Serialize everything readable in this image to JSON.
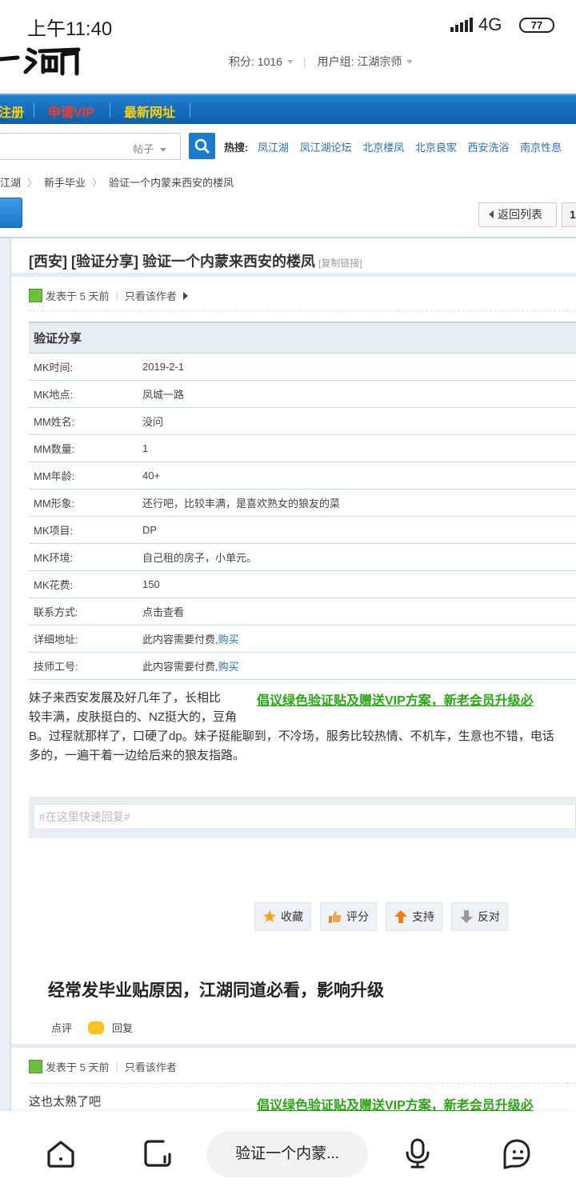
{
  "status_bar": {
    "time": "上午11:40",
    "network": "4G",
    "battery": "77"
  },
  "header": {
    "points_label": "积分: 1016",
    "usergroup_label": "用户组: 江湖宗师"
  },
  "nav": [
    {
      "label": "注册",
      "color": "#ffd200"
    },
    {
      "label": "申请VIP",
      "color": "#ff3b1f"
    },
    {
      "label": "最新网址",
      "color": "#ffd200"
    }
  ],
  "search": {
    "type": "帖子",
    "hot_label": "热搜:",
    "hot_keywords": [
      "凤江湖",
      "凤江湖论坛",
      "北京楼凤",
      "北京良家",
      "西安洗浴",
      "南京性息"
    ]
  },
  "breadcrumb": [
    "江湖",
    "新手毕业",
    "验证一个内蒙来西安的楼凤"
  ],
  "toolbar": {
    "back_label": "返回列表",
    "page": "1"
  },
  "post": {
    "title": "[西安] [验证分享] 验证一个内蒙来西安的楼凤",
    "copy_link": "[复制链接]",
    "posted": "发表于 5 天前",
    "only_author": "只看该作者",
    "table_header": "验证分享",
    "rows": [
      {
        "k": "MK时间:",
        "v": "2019-2-1",
        "link": ""
      },
      {
        "k": "MK地点:",
        "v": "凤城一路",
        "link": ""
      },
      {
        "k": "MM姓名:",
        "v": "没问",
        "link": ""
      },
      {
        "k": "MM数量:",
        "v": "1",
        "link": ""
      },
      {
        "k": "MM年龄:",
        "v": "40+",
        "link": ""
      },
      {
        "k": "MM形象:",
        "v": "还行吧，比较丰满，是喜欢熟女的狼友的菜",
        "link": ""
      },
      {
        "k": "MK项目:",
        "v": "DP",
        "link": ""
      },
      {
        "k": "MK环境:",
        "v": "自己租的房子，小单元。",
        "link": ""
      },
      {
        "k": "MK花费:",
        "v": "150",
        "link": ""
      },
      {
        "k": "联系方式:",
        "v": "点击查看",
        "link": ""
      },
      {
        "k": "详细地址:",
        "v": "此内容需要付费,",
        "link": "购买"
      },
      {
        "k": "技师工号:",
        "v": "此内容需要付费,",
        "link": "购买"
      }
    ],
    "body_line1": "妹子来西安发展及好几年了，长相比",
    "body_line2": "较丰满，皮肤挺白的、NZ挺大的，豆角",
    "body_line3": "B。过程就那样了，口硬了dp。妹子挺能聊到，不冷场，服务比较热情、不机车，生意也不错，电话",
    "body_line4": "多的，一遍干着一边给后来的狼友指路。",
    "promo": "倡议绿色验证贴及赠送VIP方案，新老会员升级必",
    "reply_placeholder": "#在这里快速回复#",
    "actions": [
      "收藏",
      "评分",
      "支持",
      "反对"
    ],
    "tip": "经常发毕业贴原因，江湖同道必看，影响升级",
    "comment_label": "点评",
    "reply_label": "回复"
  },
  "reply_post": {
    "posted": "发表于 5 天前",
    "only_author": "只看该作者",
    "text": "这也太熟了吧",
    "promo": "倡议绿色验证贴及赠送VIP方案，新老会员升级必"
  },
  "browser": {
    "url_title": "验证一个内蒙..."
  }
}
